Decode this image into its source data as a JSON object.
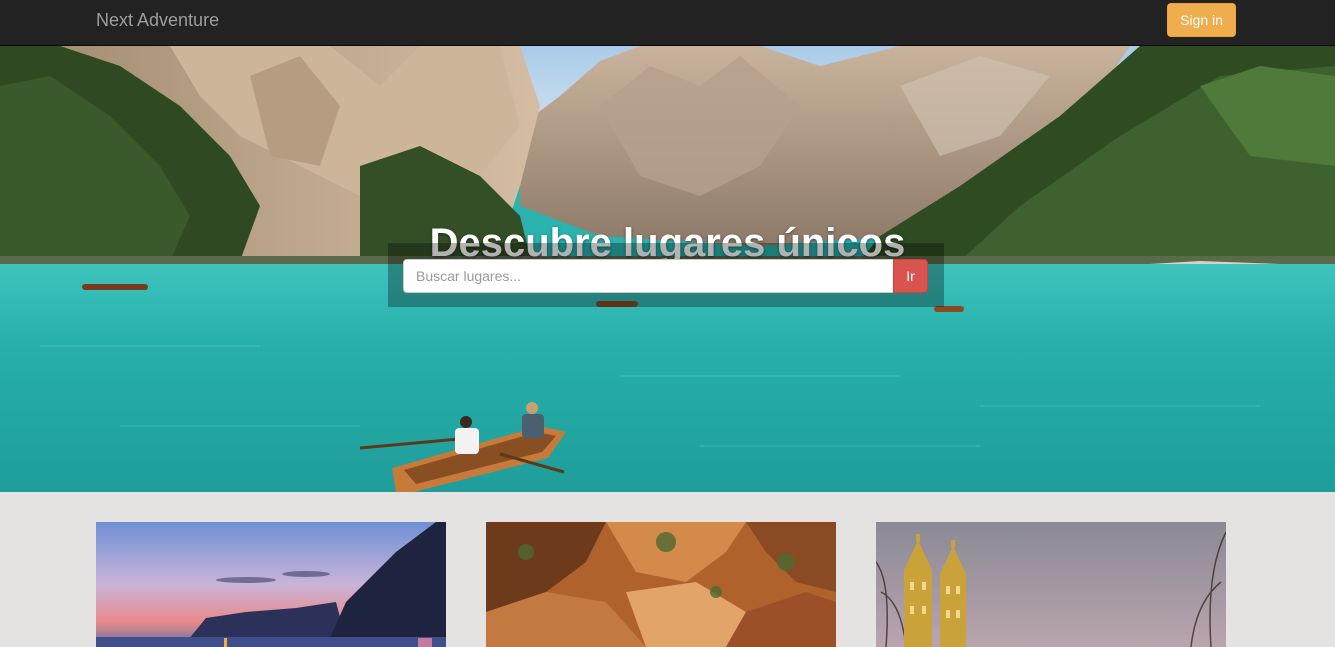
{
  "navbar": {
    "brand": "Next Adventure",
    "signin_label": "Sign in"
  },
  "hero": {
    "title": "Descubre lugares únicos",
    "image": "mountain-lake-with-rowboats"
  },
  "search": {
    "placeholder": "Buscar lugares...",
    "value": "",
    "button_label": "Ir"
  },
  "destinations": [
    {
      "image": "coastal-sunset-cliffs"
    },
    {
      "image": "red-rock-canyon"
    },
    {
      "image": "lit-cathedral-towers-at-dusk"
    }
  ],
  "colors": {
    "navbar": "#222222",
    "brand_text": "#9d9d9d",
    "signin": "#f0ad4e",
    "search_button": "#d9534f",
    "lake": "#2ab3ae",
    "page_background": "#e4e3e1"
  }
}
